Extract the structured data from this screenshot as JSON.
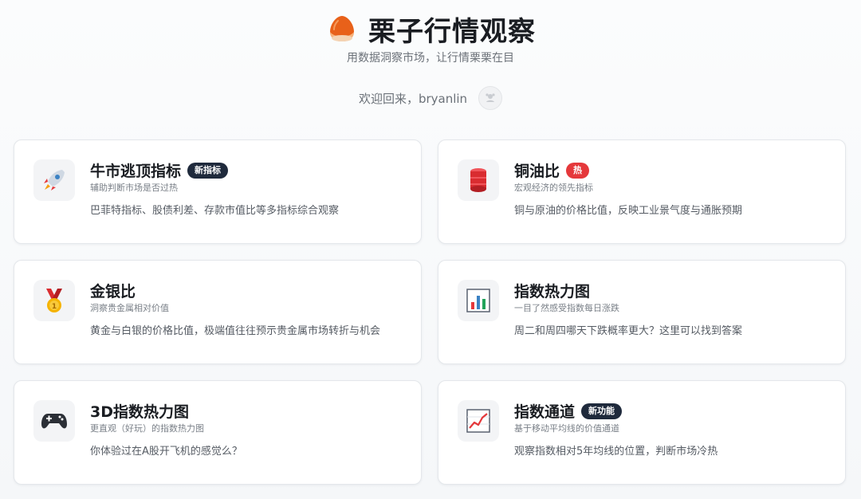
{
  "header": {
    "title": "栗子行情观察",
    "subtitle": "用数据洞察市场，让行情栗栗在目",
    "welcome": "欢迎回来，bryanlin"
  },
  "cards": [
    {
      "title": "牛市逃顶指标",
      "badge": "新指标",
      "subtitle": "辅助判断市场是否过热",
      "description": "巴菲特指标、股债利差、存款市值比等多指标综合观察",
      "icon": "rocket-icon"
    },
    {
      "title": "铜油比",
      "badge": "热",
      "subtitle": "宏观经济的领先指标",
      "description": "铜与原油的价格比值，反映工业景气度与通胀预期",
      "icon": "oil-barrel-icon"
    },
    {
      "title": "金银比",
      "badge": "",
      "subtitle": "洞察贵金属相对价值",
      "description": "黄金与白银的价格比值，极端值往往预示贵金属市场转折与机会",
      "icon": "medal-icon"
    },
    {
      "title": "指数热力图",
      "badge": "",
      "subtitle": "一目了然感受指数每日涨跌",
      "description": "周二和周四哪天下跌概率更大？这里可以找到答案",
      "icon": "bar-chart-icon"
    },
    {
      "title": "3D指数热力图",
      "badge": "",
      "subtitle": "更直观（好玩）的指数热力图",
      "description": "你体验过在A股开飞机的感觉么？",
      "icon": "gamepad-icon"
    },
    {
      "title": "指数通道",
      "badge": "新功能",
      "subtitle": "基于移动平均线的价值通道",
      "description": "观察指数相对5年均线的位置，判断市场冷热",
      "icon": "line-chart-icon"
    }
  ],
  "colors": {
    "badge_dark": "#1f2a3c",
    "badge_hot": "#e5383b",
    "logo_orange": "#e8611a"
  }
}
